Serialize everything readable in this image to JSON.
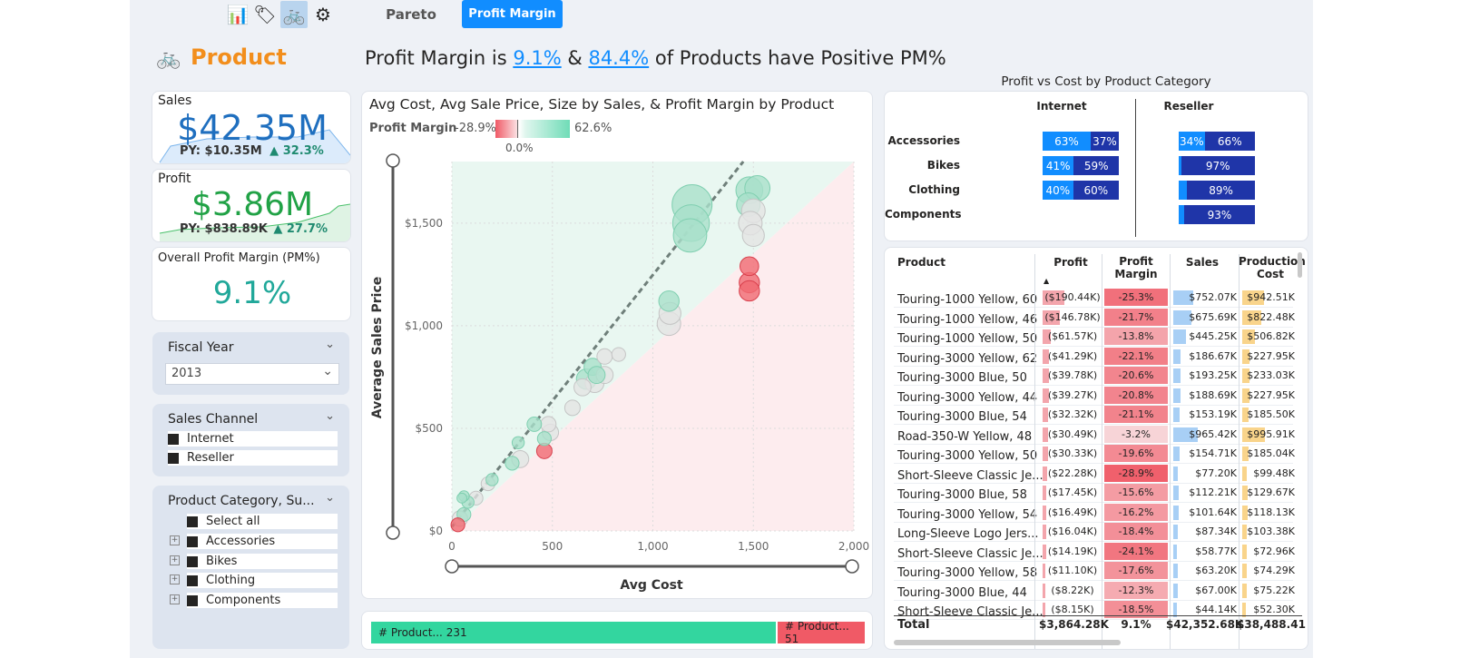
{
  "nav": {
    "icons": [
      "documents-icon",
      "tag-icon",
      "bicycle-icon",
      "network-icon"
    ],
    "tabs": [
      {
        "label": "Pareto",
        "active": false
      },
      {
        "label": "Profit Margin",
        "active": true
      }
    ]
  },
  "header": {
    "page_title": "Product",
    "headline_prefix": "Profit Margin is",
    "headline_pm": "9.1%",
    "headline_mid": "&",
    "headline_pct": "84.4%",
    "headline_suffix": "of Products have Positive PM%"
  },
  "kpis": {
    "sales": {
      "label": "Sales",
      "value": "$42.35M",
      "py": "PY: $10.35M",
      "delta": "▲ 32.3%"
    },
    "profit": {
      "label": "Profit",
      "value": "$3.86M",
      "py": "PY: $838.89K",
      "delta": "▲ 27.7%"
    },
    "margin": {
      "label": "Overall Profit Margin (PM%)",
      "value": "9.1%"
    }
  },
  "slicers": {
    "fiscal_year": {
      "title": "Fiscal Year",
      "selected": "2013"
    },
    "sales_channel": {
      "title": "Sales Channel",
      "options": [
        "Internet",
        "Reseller"
      ]
    },
    "product_category": {
      "title": "Product Category, Su...",
      "select_all": "Select all",
      "options": [
        "Accessories",
        "Bikes",
        "Clothing",
        "Components"
      ]
    }
  },
  "scatter": {
    "title": "Avg Cost, Avg Sale Price, Size by Sales, & Profit Margin by Product",
    "legend_label": "Profit Margin",
    "legend_min": "-28.9%",
    "legend_mid": "0.0%",
    "legend_max": "62.6%"
  },
  "chart_data": {
    "type": "scatter",
    "xlabel": "Avg Cost",
    "ylabel": "Average Sales Price",
    "xlim": [
      0,
      2000
    ],
    "ylim": [
      0,
      1800
    ],
    "x_ticks": [
      "0",
      "500",
      "1,000",
      "1,500",
      "2,000"
    ],
    "y_ticks": [
      "$0",
      "$500",
      "$1,000",
      "$1,500"
    ],
    "points": [
      {
        "x": 1195,
        "y": 1590,
        "s": 1.0,
        "c": "pos"
      },
      {
        "x": 1190,
        "y": 1500,
        "s": 0.9,
        "c": "pos"
      },
      {
        "x": 1185,
        "y": 1440,
        "s": 0.8,
        "c": "pos"
      },
      {
        "x": 1480,
        "y": 1660,
        "s": 0.6,
        "c": "pos"
      },
      {
        "x": 1520,
        "y": 1670,
        "s": 0.55,
        "c": "pos"
      },
      {
        "x": 1475,
        "y": 1590,
        "s": 0.5,
        "c": "pos"
      },
      {
        "x": 1500,
        "y": 1560,
        "s": 0.5,
        "c": "neutral"
      },
      {
        "x": 1485,
        "y": 1500,
        "s": 0.5,
        "c": "neutral"
      },
      {
        "x": 1500,
        "y": 1440,
        "s": 0.45,
        "c": "neutral"
      },
      {
        "x": 1480,
        "y": 1290,
        "s": 0.35,
        "c": "neg"
      },
      {
        "x": 1480,
        "y": 1210,
        "s": 0.4,
        "c": "neg"
      },
      {
        "x": 1480,
        "y": 1170,
        "s": 0.4,
        "c": "neg"
      },
      {
        "x": 1080,
        "y": 1120,
        "s": 0.4,
        "c": "pos"
      },
      {
        "x": 1085,
        "y": 1060,
        "s": 0.45,
        "c": "neutral"
      },
      {
        "x": 1080,
        "y": 1010,
        "s": 0.5,
        "c": "neutral"
      },
      {
        "x": 760,
        "y": 850,
        "s": 0.25,
        "c": "neutral"
      },
      {
        "x": 830,
        "y": 860,
        "s": 0.2,
        "c": "neutral"
      },
      {
        "x": 700,
        "y": 800,
        "s": 0.3,
        "c": "pos"
      },
      {
        "x": 670,
        "y": 740,
        "s": 0.4,
        "c": "pos"
      },
      {
        "x": 710,
        "y": 720,
        "s": 0.35,
        "c": "neutral"
      },
      {
        "x": 760,
        "y": 760,
        "s": 0.3,
        "c": "neutral"
      },
      {
        "x": 720,
        "y": 760,
        "s": 0.3,
        "c": "pos"
      },
      {
        "x": 650,
        "y": 700,
        "s": 0.3,
        "c": "neutral"
      },
      {
        "x": 600,
        "y": 600,
        "s": 0.25,
        "c": "neutral"
      },
      {
        "x": 410,
        "y": 520,
        "s": 0.22,
        "c": "pos"
      },
      {
        "x": 480,
        "y": 520,
        "s": 0.25,
        "c": "neutral"
      },
      {
        "x": 490,
        "y": 480,
        "s": 0.28,
        "c": "neutral"
      },
      {
        "x": 460,
        "y": 450,
        "s": 0.2,
        "c": "pos"
      },
      {
        "x": 460,
        "y": 390,
        "s": 0.25,
        "c": "neg"
      },
      {
        "x": 330,
        "y": 430,
        "s": 0.15,
        "c": "pos"
      },
      {
        "x": 340,
        "y": 350,
        "s": 0.3,
        "c": "neutral"
      },
      {
        "x": 300,
        "y": 330,
        "s": 0.2,
        "c": "pos"
      },
      {
        "x": 200,
        "y": 250,
        "s": 0.15,
        "c": "pos"
      },
      {
        "x": 180,
        "y": 230,
        "s": 0.2,
        "c": "neutral"
      },
      {
        "x": 120,
        "y": 160,
        "s": 0.2,
        "c": "neutral"
      },
      {
        "x": 80,
        "y": 140,
        "s": 0.15,
        "c": "pos"
      },
      {
        "x": 60,
        "y": 80,
        "s": 0.2,
        "c": "pos"
      },
      {
        "x": 40,
        "y": 60,
        "s": 0.25,
        "c": "neutral"
      },
      {
        "x": 30,
        "y": 30,
        "s": 0.2,
        "c": "neg"
      },
      {
        "x": 60,
        "y": 170,
        "s": 0.1,
        "c": "pos"
      },
      {
        "x": 50,
        "y": 160,
        "s": 0.08,
        "c": "pos"
      }
    ]
  },
  "count_bar": {
    "positive_label": "# Product... 231",
    "negative_label": "# Product... 51",
    "positive": 231,
    "negative": 51
  },
  "category": {
    "title": "Profit vs Cost by Product Category",
    "channels": [
      "Internet",
      "Reseller"
    ],
    "rows": [
      {
        "name": "Accessories",
        "internet": [
          "63%",
          "37%"
        ],
        "internet_vals": [
          63,
          37
        ],
        "reseller": [
          "34%",
          "66%"
        ],
        "reseller_vals": [
          34,
          66
        ]
      },
      {
        "name": "Bikes",
        "internet": [
          "41%",
          "59%"
        ],
        "internet_vals": [
          41,
          59
        ],
        "reseller": [
          "",
          "97%"
        ],
        "reseller_vals": [
          3,
          97
        ]
      },
      {
        "name": "Clothing",
        "internet": [
          "40%",
          "60%"
        ],
        "internet_vals": [
          40,
          60
        ],
        "reseller": [
          "",
          "89%"
        ],
        "reseller_vals": [
          11,
          89
        ]
      },
      {
        "name": "Components",
        "internet": [
          "",
          ""
        ],
        "internet_vals": [
          0,
          0
        ],
        "reseller": [
          "",
          "93%"
        ],
        "reseller_vals": [
          7,
          93
        ]
      }
    ]
  },
  "table": {
    "headers": [
      "Product",
      "Profit",
      "Profit Margin",
      "Sales",
      "Production Cost"
    ],
    "rows": [
      {
        "product": "Touring-1000 Yellow, 60",
        "profit": "($190.44K)",
        "pm": "-25.3%",
        "sales": "$752.07K",
        "cost": "$942.51K",
        "pv": 190.44,
        "pmv": -25.3,
        "sv": 752.07,
        "cv": 942.51
      },
      {
        "product": "Touring-1000 Yellow, 46",
        "profit": "($146.78K)",
        "pm": "-21.7%",
        "sales": "$675.69K",
        "cost": "$822.48K",
        "pv": 146.78,
        "pmv": -21.7,
        "sv": 675.69,
        "cv": 822.48
      },
      {
        "product": "Touring-1000 Yellow, 50",
        "profit": "($61.57K)",
        "pm": "-13.8%",
        "sales": "$445.25K",
        "cost": "$506.82K",
        "pv": 61.57,
        "pmv": -13.8,
        "sv": 445.25,
        "cv": 506.82
      },
      {
        "product": "Touring-3000 Yellow, 62",
        "profit": "($41.29K)",
        "pm": "-22.1%",
        "sales": "$186.67K",
        "cost": "$227.95K",
        "pv": 41.29,
        "pmv": -22.1,
        "sv": 186.67,
        "cv": 227.95
      },
      {
        "product": "Touring-3000 Blue, 50",
        "profit": "($39.78K)",
        "pm": "-20.6%",
        "sales": "$193.25K",
        "cost": "$233.03K",
        "pv": 39.78,
        "pmv": -20.6,
        "sv": 193.25,
        "cv": 233.03
      },
      {
        "product": "Touring-3000 Yellow, 44",
        "profit": "($39.27K)",
        "pm": "-20.8%",
        "sales": "$188.69K",
        "cost": "$227.95K",
        "pv": 39.27,
        "pmv": -20.8,
        "sv": 188.69,
        "cv": 227.95
      },
      {
        "product": "Touring-3000 Blue, 54",
        "profit": "($32.32K)",
        "pm": "-21.1%",
        "sales": "$153.19K",
        "cost": "$185.50K",
        "pv": 32.32,
        "pmv": -21.1,
        "sv": 153.19,
        "cv": 185.5
      },
      {
        "product": "Road-350-W Yellow, 48",
        "profit": "($30.49K)",
        "pm": "-3.2%",
        "sales": "$965.42K",
        "cost": "$995.91K",
        "pv": 30.49,
        "pmv": -3.2,
        "sv": 965.42,
        "cv": 995.91
      },
      {
        "product": "Touring-3000 Yellow, 50",
        "profit": "($30.33K)",
        "pm": "-19.6%",
        "sales": "$154.71K",
        "cost": "$185.04K",
        "pv": 30.33,
        "pmv": -19.6,
        "sv": 154.71,
        "cv": 185.04
      },
      {
        "product": "Short-Sleeve Classic Je...",
        "profit": "($22.28K)",
        "pm": "-28.9%",
        "sales": "$77.20K",
        "cost": "$99.48K",
        "pv": 22.28,
        "pmv": -28.9,
        "sv": 77.2,
        "cv": 99.48
      },
      {
        "product": "Touring-3000 Blue, 58",
        "profit": "($17.45K)",
        "pm": "-15.6%",
        "sales": "$112.21K",
        "cost": "$129.67K",
        "pv": 17.45,
        "pmv": -15.6,
        "sv": 112.21,
        "cv": 129.67
      },
      {
        "product": "Touring-3000 Yellow, 54",
        "profit": "($16.49K)",
        "pm": "-16.2%",
        "sales": "$101.64K",
        "cost": "$118.13K",
        "pv": 16.49,
        "pmv": -16.2,
        "sv": 101.64,
        "cv": 118.13
      },
      {
        "product": "Long-Sleeve Logo Jers...",
        "profit": "($16.04K)",
        "pm": "-18.4%",
        "sales": "$87.34K",
        "cost": "$103.38K",
        "pv": 16.04,
        "pmv": -18.4,
        "sv": 87.34,
        "cv": 103.38
      },
      {
        "product": "Short-Sleeve Classic Je...",
        "profit": "($14.19K)",
        "pm": "-24.1%",
        "sales": "$58.77K",
        "cost": "$72.96K",
        "pv": 14.19,
        "pmv": -24.1,
        "sv": 58.77,
        "cv": 72.96
      },
      {
        "product": "Touring-3000 Yellow, 58",
        "profit": "($11.10K)",
        "pm": "-17.6%",
        "sales": "$63.20K",
        "cost": "$74.29K",
        "pv": 11.1,
        "pmv": -17.6,
        "sv": 63.2,
        "cv": 74.29
      },
      {
        "product": "Touring-3000 Blue, 44",
        "profit": "($8.22K)",
        "pm": "-12.3%",
        "sales": "$67.00K",
        "cost": "$75.22K",
        "pv": 8.22,
        "pmv": -12.3,
        "sv": 67.0,
        "cv": 75.22
      },
      {
        "product": "Short-Sleeve Classic Je...",
        "profit": "($8.15K)",
        "pm": "-18.5%",
        "sales": "$44.14K",
        "cost": "$52.30K",
        "pv": 8.15,
        "pmv": -18.5,
        "sv": 44.14,
        "cv": 52.3
      }
    ],
    "total": {
      "label": "Total",
      "profit": "$3,864.28K",
      "pm": "9.1%",
      "sales": "$42,352.68K",
      "cost": "$38,488.41"
    }
  },
  "colors": {
    "accent": "#118dff",
    "orange": "#f28e1c",
    "dark_blue": "#1f35a8",
    "green": "#33d69f",
    "red": "#f05a66",
    "pos_fill": "#a9e0cb",
    "neg_fill": "#f06a72"
  }
}
